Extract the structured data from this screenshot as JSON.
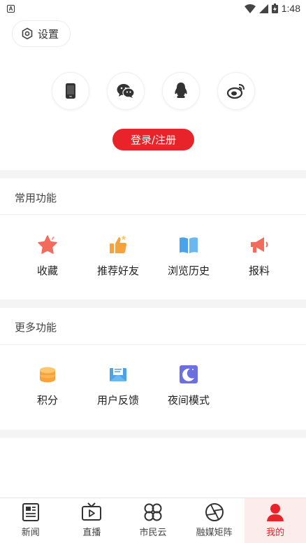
{
  "status_bar": {
    "time": "1:48"
  },
  "settings": {
    "label": "设置"
  },
  "login": {
    "icons": [
      "phone-icon",
      "wechat-icon",
      "qq-icon",
      "weibo-icon"
    ],
    "button_label": "登录/注册"
  },
  "common": {
    "title": "常用功能",
    "items": [
      {
        "label": "收藏",
        "icon": "star-icon"
      },
      {
        "label": "推荐好友",
        "icon": "thumbs-up-icon"
      },
      {
        "label": "浏览历史",
        "icon": "book-icon"
      },
      {
        "label": "报料",
        "icon": "megaphone-icon"
      }
    ]
  },
  "more": {
    "title": "更多功能",
    "items": [
      {
        "label": "积分",
        "icon": "coins-icon"
      },
      {
        "label": "用户反馈",
        "icon": "mail-icon"
      },
      {
        "label": "夜间模式",
        "icon": "moon-icon"
      }
    ]
  },
  "nav": {
    "items": [
      {
        "label": "新闻",
        "icon": "news-icon"
      },
      {
        "label": "直播",
        "icon": "tv-icon"
      },
      {
        "label": "市民云",
        "icon": "clover-icon"
      },
      {
        "label": "融媒矩阵",
        "icon": "aperture-icon"
      },
      {
        "label": "我的",
        "icon": "person-icon"
      }
    ],
    "active_color": "#e8232a"
  },
  "colors": {
    "brand": "#e8232a",
    "separator": "#f4f4f4"
  }
}
